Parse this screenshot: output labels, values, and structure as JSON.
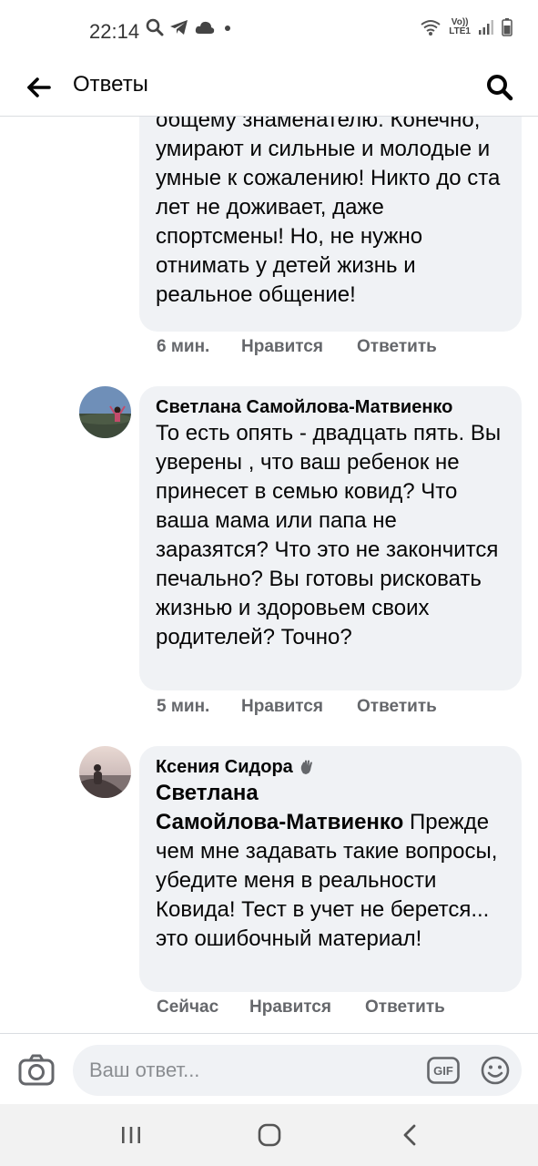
{
  "status_bar": {
    "time": "22:14",
    "left_icons": [
      "search-icon",
      "telegram-icon",
      "cloud-icon",
      "dot-icon"
    ],
    "right_icons": [
      "wifi-icon",
      "volte-lte-icon",
      "signal-icon",
      "battery-icon"
    ],
    "lte_top": "Vo))",
    "lte_bottom": "LTE1"
  },
  "header": {
    "title": "Ответы",
    "back_icon": "back-arrow-icon",
    "search_icon": "search-icon"
  },
  "comments": [
    {
      "author": "",
      "text": "общему знаменателю. Конечно, умирают и сильные и молодые и умные к сожалению! Никто до ста лет не доживает, даже спортсмены! Но, не нужно отнимать у детей жизнь и реальное общение!",
      "time": "6 мин.",
      "like": "Нравится",
      "reply": "Ответить"
    },
    {
      "author": "Светлана Самойлова-Матвиенко",
      "text": "То есть опять - двадцать пять. Вы уверены , что ваш ребенок не принесет в семью ковид? Что ваша мама или папа не заразятся? Что это не закончится печально? Вы готовы рисковать жизнью и здоровьем своих родителей? Точно?",
      "time": "5 мин.",
      "like": "Нравится",
      "reply": "Ответить"
    },
    {
      "author": "Ксения Сидора",
      "author_badge_icon": "waving-hand-icon",
      "mention_line1": "Светлана",
      "mention_line2": "Самойлова-Матвиенко",
      "text_line2_rest": " Прежде",
      "text_rest": "чем мне задавать такие вопросы, убедите меня в реальности Ковида! Тест в учет не берется... это ошибочный материал!",
      "time": "Сейчас",
      "like": "Нравится",
      "reply": "Ответить"
    }
  ],
  "reply_bar": {
    "placeholder": "Ваш ответ...",
    "camera_icon": "camera-icon",
    "gif_label": "GIF",
    "emoji_icon": "smiley-icon"
  },
  "nav_bar": {
    "buttons": [
      "recent-apps-icon",
      "home-icon",
      "back-chevron-icon"
    ]
  },
  "colors": {
    "bubble": "#f0f2f5",
    "secondary_text": "#65676b",
    "primary_text": "#050505",
    "nav_bar_bg": "#f2f2f2"
  }
}
